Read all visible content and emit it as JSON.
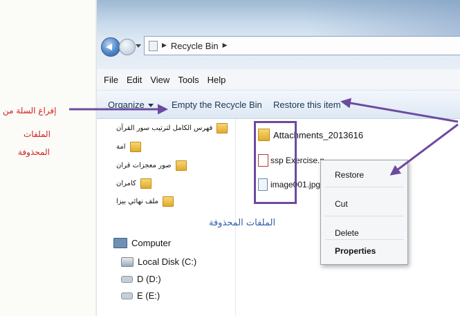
{
  "explorer": {
    "address": "Recycle Bin",
    "menu": [
      "File",
      "Edit",
      "View",
      "Tools",
      "Help"
    ],
    "toolbar": {
      "organize": "Organize",
      "empty": "Empty the Recycle Bin",
      "restore": "Restore this item"
    },
    "nav_folders": [
      "فهرس الكامل لترتيب سور القرآن",
      "امة",
      "صور معجزات قران",
      "كامران",
      "ملف نهائي بيزا"
    ],
    "nav_devices": [
      "Computer",
      "Local Disk (C:)",
      "D (D:)",
      "E (E:)"
    ],
    "files": [
      "Attachments_2013616",
      "ssp Exercise.p",
      "image001.jpg"
    ]
  },
  "context_menu": [
    "Restore",
    "Cut",
    "Delete",
    "Properties"
  ],
  "annotations": {
    "empty_line1": "إفراغ السلة من",
    "empty_line2": "الملفات",
    "empty_line3": "المحذوفة",
    "deleted_files": "الملفات المحذوفة"
  },
  "colors": {
    "arrow": "#6c4aa0",
    "annotation_red": "#d0221c",
    "annotation_blue": "#2d5fa6"
  }
}
